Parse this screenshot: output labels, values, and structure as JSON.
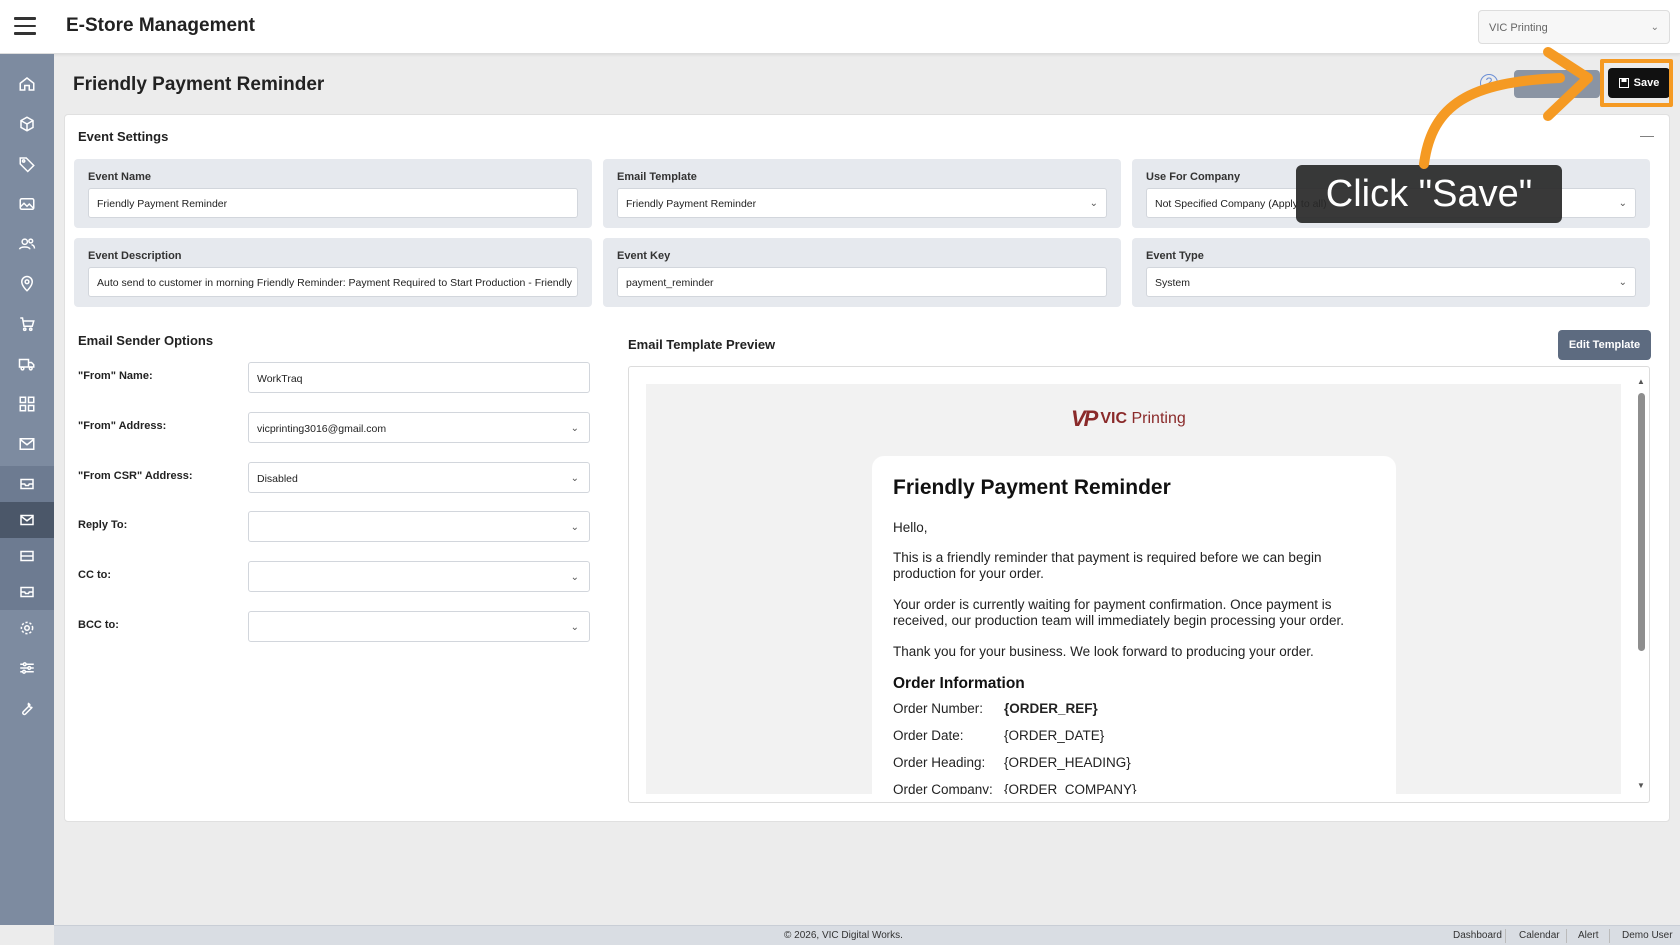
{
  "header": {
    "app_title": "E-Store Management",
    "company_selector": "VIC Printing"
  },
  "page": {
    "title": "Friendly Payment Reminder",
    "save_label": "Save"
  },
  "event_settings": {
    "section_title": "Event Settings",
    "event_name": {
      "label": "Event Name",
      "value": "Friendly Payment Reminder"
    },
    "email_template": {
      "label": "Email Template",
      "value": "Friendly Payment Reminder"
    },
    "use_for_company": {
      "label": "Use For Company",
      "value": "Not Specified Company (Apply to all)"
    },
    "event_description": {
      "label": "Event Description",
      "value": "Auto send to customer in morning Friendly Reminder: Payment Required to Start Production - Friendly"
    },
    "event_key": {
      "label": "Event Key",
      "value": "payment_reminder"
    },
    "event_type": {
      "label": "Event Type",
      "value": "System"
    }
  },
  "sender_options": {
    "section_title": "Email Sender Options",
    "from_name": {
      "label": "\"From\" Name:",
      "value": "WorkTraq"
    },
    "from_address": {
      "label": "\"From\" Address:",
      "value": "vicprinting3016@gmail.com"
    },
    "from_csr": {
      "label": "\"From CSR\" Address:",
      "value": "Disabled"
    },
    "reply_to": {
      "label": "Reply To:",
      "value": ""
    },
    "cc_to": {
      "label": "CC to:",
      "value": ""
    },
    "bcc_to": {
      "label": "BCC to:",
      "value": ""
    }
  },
  "preview": {
    "section_title": "Email Template Preview",
    "edit_label": "Edit Template",
    "logo_mark": "VP",
    "logo_brand": "VIC",
    "logo_word": "Printing",
    "heading": "Friendly Payment Reminder",
    "greeting": "Hello,",
    "paragraph_1": "This is a friendly reminder that payment is required before we can begin production for your order.",
    "paragraph_2": "Your order is currently waiting for payment confirmation. Once payment is received, our production team will immediately begin processing your order.",
    "paragraph_3": "Thank you for your business. We look forward to producing your order.",
    "order_heading": "Order Information",
    "order_rows": [
      {
        "label": "Order Number:",
        "value": "{ORDER_REF}"
      },
      {
        "label": "Order Date:",
        "value": "{ORDER_DATE}"
      },
      {
        "label": "Order Heading:",
        "value": "{ORDER_HEADING}"
      },
      {
        "label": "Order Company:",
        "value": "{ORDER_COMPANY}"
      }
    ]
  },
  "tooltip": {
    "text": "Click \"Save\"",
    "color": "#f59a23"
  },
  "footer": {
    "copyright": "© 2026, VIC Digital Works.",
    "links": [
      "Dashboard",
      "Calendar",
      "Alert",
      "Demo User"
    ]
  },
  "colors": {
    "sidebar": "#7d8ba0",
    "save_button": "#111111",
    "highlight": "#f59a23",
    "edit_template": "#5d6b80"
  }
}
